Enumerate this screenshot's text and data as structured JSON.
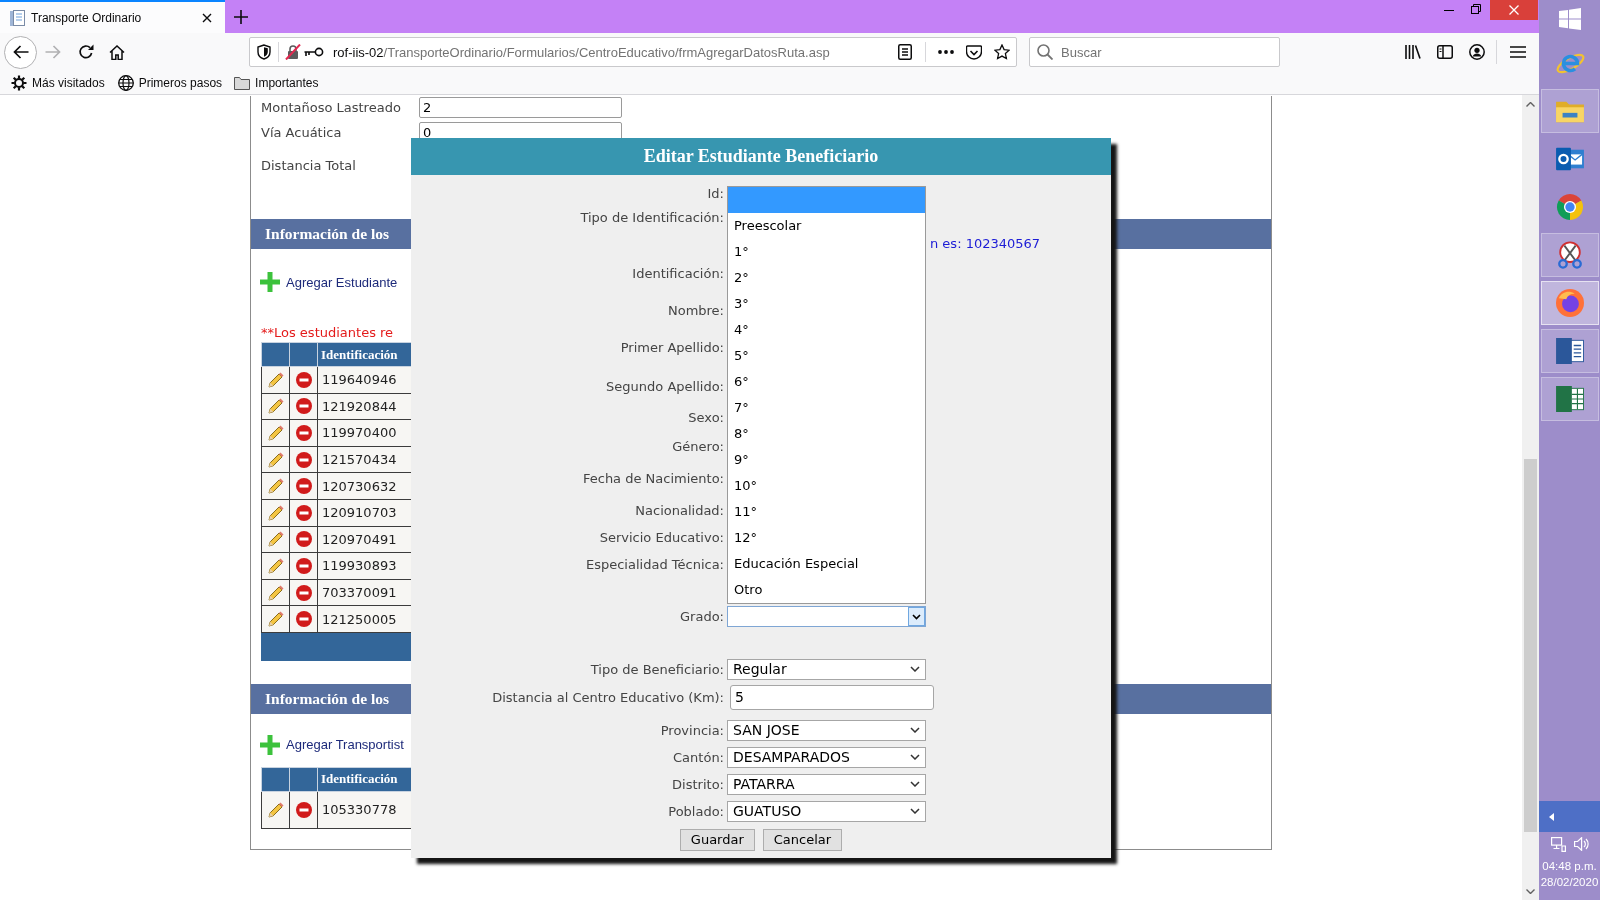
{
  "browser": {
    "tab_title": "Transporte Ordinario",
    "url_host": "rof-iis-02",
    "url_path": "/TransporteOrdinario/Formularios/CentroEducativo/frmAgregarDatosRuta.asp",
    "search_placeholder": "Buscar",
    "bookmarks": [
      "Más visitados",
      "Primeros pasos",
      "Importantes"
    ]
  },
  "page": {
    "distance_rows": [
      {
        "label": "Montañoso Lastreado",
        "value": "2"
      },
      {
        "label": "Vía Acuática",
        "value": "0"
      },
      {
        "label": "Distancia Total"
      }
    ],
    "sections": [
      {
        "title": "Información de los",
        "add_link": "Agregar Estudiante",
        "note": "**Los estudiantes re",
        "columns": [
          "Identificación"
        ],
        "rows": [
          "119640946",
          "121920844",
          "119970400",
          "121570434",
          "120730632",
          "120910703",
          "120970491",
          "119930893",
          "703370091",
          "121250005"
        ],
        "pager_bar": true
      },
      {
        "title": "Información de los",
        "add_link": "Agregar Transportist",
        "columns": [
          "Identificación"
        ],
        "rows": [
          "105330778"
        ]
      }
    ]
  },
  "dialog": {
    "title": "Editar Estudiante Beneficiario",
    "fields": [
      {
        "label": "Id:"
      },
      {
        "label": "Tipo de Identificación:",
        "hint": "n es: 102340567"
      },
      {
        "label": "Identificación:"
      },
      {
        "label": "Nombre:"
      },
      {
        "label": "Primer Apellido:"
      },
      {
        "label": "Segundo Apellido:"
      },
      {
        "label": "Sexo:"
      },
      {
        "label": "Género:"
      },
      {
        "label": "Fecha de Nacimiento:"
      },
      {
        "label": "Nacionalidad:"
      },
      {
        "label": "Servicio Educativo:"
      },
      {
        "label": "Especialidad Técnica:"
      },
      {
        "label": "Grado:",
        "kind": "select",
        "expanded": true,
        "options": [
          {
            "selected": true
          },
          {
            "label": "Preescolar",
            "selected": false
          },
          {
            "label": "1°",
            "selected": false
          },
          {
            "label": "2°",
            "selected": false
          },
          {
            "label": "3°",
            "selected": false
          },
          {
            "label": "4°",
            "selected": false
          },
          {
            "label": "5°",
            "selected": false
          },
          {
            "label": "6°",
            "selected": false
          },
          {
            "label": "7°",
            "selected": false
          },
          {
            "label": "8°",
            "selected": false
          },
          {
            "label": "9°",
            "selected": false
          },
          {
            "label": "10°",
            "selected": false
          },
          {
            "label": "11°",
            "selected": false
          },
          {
            "label": "12°",
            "selected": false
          },
          {
            "label": "Educación Especial",
            "selected": false
          },
          {
            "label": "Otro",
            "selected": false
          }
        ]
      },
      {
        "label": "Tipo de Beneficiario:",
        "kind": "select",
        "expanded": false,
        "value": "Regular"
      },
      {
        "label": "Distancia al Centro Educativo (Km):",
        "kind": "input",
        "value": "5"
      },
      {
        "label": "Provincia:",
        "kind": "select",
        "expanded": false,
        "value": "SAN JOSE"
      },
      {
        "label": "Cantón:",
        "kind": "select",
        "expanded": false,
        "value": "DESAMPARADOS"
      },
      {
        "label": "Distrito:",
        "kind": "select",
        "expanded": false,
        "value": "PATARRA"
      },
      {
        "label": "Poblado:",
        "kind": "select",
        "expanded": false,
        "value": "GUATUSO"
      }
    ],
    "buttons": [
      "Guardar",
      "Cancelar"
    ]
  },
  "taskbar": {
    "apps": [
      {
        "running": false,
        "active": false
      },
      {
        "running": true,
        "active": false
      },
      {
        "running": false,
        "active": false
      },
      {
        "running": false,
        "active": false
      },
      {
        "running": true,
        "active": false
      },
      {
        "running": true,
        "active": true
      },
      {
        "running": true,
        "active": false
      },
      {
        "running": true,
        "active": false
      }
    ],
    "time": "04:48 p.m.",
    "date": "28/02/2020"
  }
}
